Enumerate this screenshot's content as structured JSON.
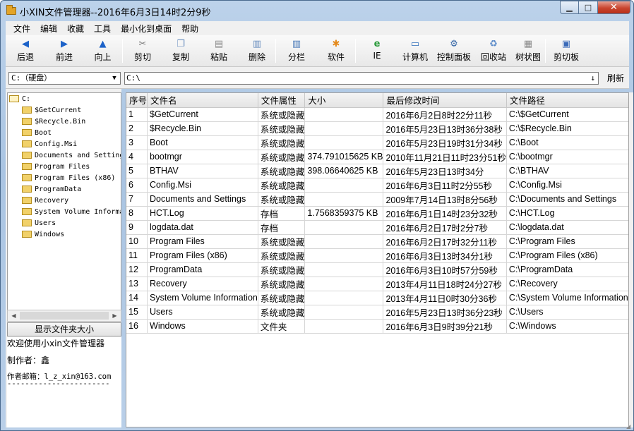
{
  "window": {
    "title": "小XIN文件管理器--2016年6月3日14时2分9秒"
  },
  "menu": [
    "文件",
    "编辑",
    "收藏",
    "工具",
    "最小化到桌面",
    "帮助"
  ],
  "toolbar": {
    "back": "后退",
    "forward": "前进",
    "up": "向上",
    "cut": "剪切",
    "copy": "复制",
    "paste": "粘贴",
    "delete": "删除",
    "split": "分栏",
    "software": "软件",
    "ie": "IE",
    "computer": "计算机",
    "control_panel": "控制面板",
    "recycle_bin": "回收站",
    "tree_view": "树状图",
    "clipboard": "剪切板"
  },
  "address": {
    "drive": "C:（硬盘）",
    "path": "C:\\",
    "refresh": "刷新"
  },
  "tree": {
    "root": "C:",
    "items": [
      "$GetCurrent",
      "$Recycle.Bin",
      "Boot",
      "Config.Msi",
      "Documents and Settings",
      "Program Files",
      "Program Files (x86)",
      "ProgramData",
      "Recovery",
      "System Volume Information",
      "Users",
      "Windows"
    ]
  },
  "left_panel": {
    "show_size_button": "显示文件夹大小",
    "welcome": "欢迎使用小xin文件管理器",
    "author": "制作者：鑫",
    "email": "作者邮箱：l_z_xin@163.com",
    "dashes": "-----------------------"
  },
  "table": {
    "headers": [
      "序号",
      "文件名",
      "文件属性",
      "大小",
      "最后修改时间",
      "文件路径"
    ],
    "rows": [
      [
        "1",
        "$GetCurrent",
        "系统或隐藏",
        "",
        "2016年6月2日8时22分11秒",
        "C:\\$GetCurrent"
      ],
      [
        "2",
        "$Recycle.Bin",
        "系统或隐藏",
        "",
        "2016年5月23日13时36分38秒",
        "C:\\$Recycle.Bin"
      ],
      [
        "3",
        "Boot",
        "系统或隐藏",
        "",
        "2016年5月23日19时31分34秒",
        "C:\\Boot"
      ],
      [
        "4",
        "bootmgr",
        "系统或隐藏",
        "374.791015625 KB",
        "2010年11月21日11时23分51秒",
        "C:\\bootmgr"
      ],
      [
        "5",
        "BTHAV",
        "系统或隐藏",
        "398.06640625 KB",
        "2016年5月23日13时34分",
        "C:\\BTHAV"
      ],
      [
        "6",
        "Config.Msi",
        "系统或隐藏",
        "",
        "2016年6月3日11时2分55秒",
        "C:\\Config.Msi"
      ],
      [
        "7",
        "Documents and Settings",
        "系统或隐藏",
        "",
        "2009年7月14日13时8分56秒",
        "C:\\Documents and Settings"
      ],
      [
        "8",
        "HCT.Log",
        "存档",
        "1.7568359375 KB",
        "2016年6月1日14时23分32秒",
        "C:\\HCT.Log"
      ],
      [
        "9",
        "logdata.dat",
        "存档",
        "",
        "2016年6月2日17时2分7秒",
        "C:\\logdata.dat"
      ],
      [
        "10",
        "Program Files",
        "系统或隐藏",
        "",
        "2016年6月2日17时32分11秒",
        "C:\\Program Files"
      ],
      [
        "11",
        "Program Files (x86)",
        "系统或隐藏",
        "",
        "2016年6月3日13时34分1秒",
        "C:\\Program Files (x86)"
      ],
      [
        "12",
        "ProgramData",
        "系统或隐藏",
        "",
        "2016年6月3日10时57分59秒",
        "C:\\ProgramData"
      ],
      [
        "13",
        "Recovery",
        "系统或隐藏",
        "",
        "2013年4月11日18时24分27秒",
        "C:\\Recovery"
      ],
      [
        "14",
        "System Volume Information",
        "系统或隐藏",
        "",
        "2013年4月11日0时30分36秒",
        "C:\\System Volume Information"
      ],
      [
        "15",
        "Users",
        "系统或隐藏",
        "",
        "2016年5月23日13时36分23秒",
        "C:\\Users"
      ],
      [
        "16",
        "Windows",
        "文件夹",
        "",
        "2016年6月3日9时39分21秒",
        "C:\\Windows"
      ]
    ]
  }
}
